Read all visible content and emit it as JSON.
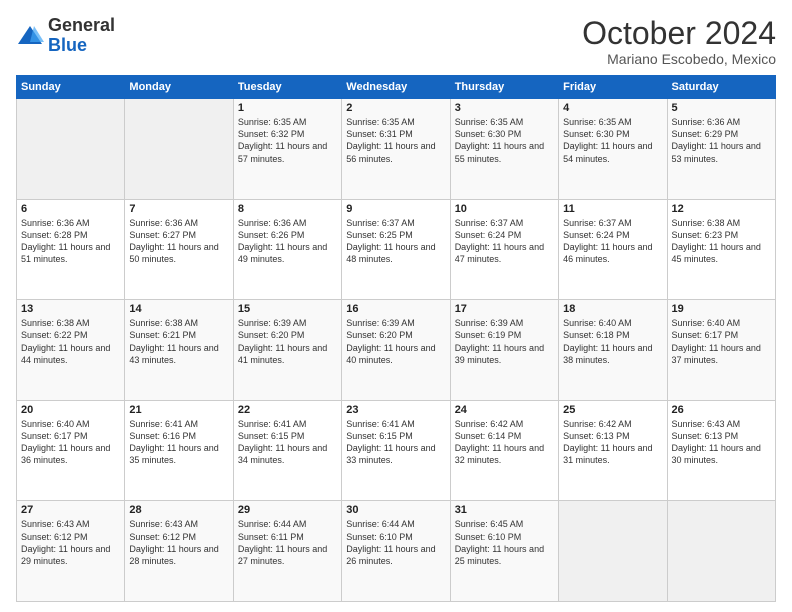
{
  "logo": {
    "general": "General",
    "blue": "Blue"
  },
  "header": {
    "month": "October 2024",
    "location": "Mariano Escobedo, Mexico"
  },
  "days_of_week": [
    "Sunday",
    "Monday",
    "Tuesday",
    "Wednesday",
    "Thursday",
    "Friday",
    "Saturday"
  ],
  "weeks": [
    [
      {
        "day": "",
        "sunrise": "",
        "sunset": "",
        "daylight": ""
      },
      {
        "day": "",
        "sunrise": "",
        "sunset": "",
        "daylight": ""
      },
      {
        "day": "1",
        "sunrise": "Sunrise: 6:35 AM",
        "sunset": "Sunset: 6:32 PM",
        "daylight": "Daylight: 11 hours and 57 minutes."
      },
      {
        "day": "2",
        "sunrise": "Sunrise: 6:35 AM",
        "sunset": "Sunset: 6:31 PM",
        "daylight": "Daylight: 11 hours and 56 minutes."
      },
      {
        "day": "3",
        "sunrise": "Sunrise: 6:35 AM",
        "sunset": "Sunset: 6:30 PM",
        "daylight": "Daylight: 11 hours and 55 minutes."
      },
      {
        "day": "4",
        "sunrise": "Sunrise: 6:35 AM",
        "sunset": "Sunset: 6:30 PM",
        "daylight": "Daylight: 11 hours and 54 minutes."
      },
      {
        "day": "5",
        "sunrise": "Sunrise: 6:36 AM",
        "sunset": "Sunset: 6:29 PM",
        "daylight": "Daylight: 11 hours and 53 minutes."
      }
    ],
    [
      {
        "day": "6",
        "sunrise": "Sunrise: 6:36 AM",
        "sunset": "Sunset: 6:28 PM",
        "daylight": "Daylight: 11 hours and 51 minutes."
      },
      {
        "day": "7",
        "sunrise": "Sunrise: 6:36 AM",
        "sunset": "Sunset: 6:27 PM",
        "daylight": "Daylight: 11 hours and 50 minutes."
      },
      {
        "day": "8",
        "sunrise": "Sunrise: 6:36 AM",
        "sunset": "Sunset: 6:26 PM",
        "daylight": "Daylight: 11 hours and 49 minutes."
      },
      {
        "day": "9",
        "sunrise": "Sunrise: 6:37 AM",
        "sunset": "Sunset: 6:25 PM",
        "daylight": "Daylight: 11 hours and 48 minutes."
      },
      {
        "day": "10",
        "sunrise": "Sunrise: 6:37 AM",
        "sunset": "Sunset: 6:24 PM",
        "daylight": "Daylight: 11 hours and 47 minutes."
      },
      {
        "day": "11",
        "sunrise": "Sunrise: 6:37 AM",
        "sunset": "Sunset: 6:24 PM",
        "daylight": "Daylight: 11 hours and 46 minutes."
      },
      {
        "day": "12",
        "sunrise": "Sunrise: 6:38 AM",
        "sunset": "Sunset: 6:23 PM",
        "daylight": "Daylight: 11 hours and 45 minutes."
      }
    ],
    [
      {
        "day": "13",
        "sunrise": "Sunrise: 6:38 AM",
        "sunset": "Sunset: 6:22 PM",
        "daylight": "Daylight: 11 hours and 44 minutes."
      },
      {
        "day": "14",
        "sunrise": "Sunrise: 6:38 AM",
        "sunset": "Sunset: 6:21 PM",
        "daylight": "Daylight: 11 hours and 43 minutes."
      },
      {
        "day": "15",
        "sunrise": "Sunrise: 6:39 AM",
        "sunset": "Sunset: 6:20 PM",
        "daylight": "Daylight: 11 hours and 41 minutes."
      },
      {
        "day": "16",
        "sunrise": "Sunrise: 6:39 AM",
        "sunset": "Sunset: 6:20 PM",
        "daylight": "Daylight: 11 hours and 40 minutes."
      },
      {
        "day": "17",
        "sunrise": "Sunrise: 6:39 AM",
        "sunset": "Sunset: 6:19 PM",
        "daylight": "Daylight: 11 hours and 39 minutes."
      },
      {
        "day": "18",
        "sunrise": "Sunrise: 6:40 AM",
        "sunset": "Sunset: 6:18 PM",
        "daylight": "Daylight: 11 hours and 38 minutes."
      },
      {
        "day": "19",
        "sunrise": "Sunrise: 6:40 AM",
        "sunset": "Sunset: 6:17 PM",
        "daylight": "Daylight: 11 hours and 37 minutes."
      }
    ],
    [
      {
        "day": "20",
        "sunrise": "Sunrise: 6:40 AM",
        "sunset": "Sunset: 6:17 PM",
        "daylight": "Daylight: 11 hours and 36 minutes."
      },
      {
        "day": "21",
        "sunrise": "Sunrise: 6:41 AM",
        "sunset": "Sunset: 6:16 PM",
        "daylight": "Daylight: 11 hours and 35 minutes."
      },
      {
        "day": "22",
        "sunrise": "Sunrise: 6:41 AM",
        "sunset": "Sunset: 6:15 PM",
        "daylight": "Daylight: 11 hours and 34 minutes."
      },
      {
        "day": "23",
        "sunrise": "Sunrise: 6:41 AM",
        "sunset": "Sunset: 6:15 PM",
        "daylight": "Daylight: 11 hours and 33 minutes."
      },
      {
        "day": "24",
        "sunrise": "Sunrise: 6:42 AM",
        "sunset": "Sunset: 6:14 PM",
        "daylight": "Daylight: 11 hours and 32 minutes."
      },
      {
        "day": "25",
        "sunrise": "Sunrise: 6:42 AM",
        "sunset": "Sunset: 6:13 PM",
        "daylight": "Daylight: 11 hours and 31 minutes."
      },
      {
        "day": "26",
        "sunrise": "Sunrise: 6:43 AM",
        "sunset": "Sunset: 6:13 PM",
        "daylight": "Daylight: 11 hours and 30 minutes."
      }
    ],
    [
      {
        "day": "27",
        "sunrise": "Sunrise: 6:43 AM",
        "sunset": "Sunset: 6:12 PM",
        "daylight": "Daylight: 11 hours and 29 minutes."
      },
      {
        "day": "28",
        "sunrise": "Sunrise: 6:43 AM",
        "sunset": "Sunset: 6:12 PM",
        "daylight": "Daylight: 11 hours and 28 minutes."
      },
      {
        "day": "29",
        "sunrise": "Sunrise: 6:44 AM",
        "sunset": "Sunset: 6:11 PM",
        "daylight": "Daylight: 11 hours and 27 minutes."
      },
      {
        "day": "30",
        "sunrise": "Sunrise: 6:44 AM",
        "sunset": "Sunset: 6:10 PM",
        "daylight": "Daylight: 11 hours and 26 minutes."
      },
      {
        "day": "31",
        "sunrise": "Sunrise: 6:45 AM",
        "sunset": "Sunset: 6:10 PM",
        "daylight": "Daylight: 11 hours and 25 minutes."
      },
      {
        "day": "",
        "sunrise": "",
        "sunset": "",
        "daylight": ""
      },
      {
        "day": "",
        "sunrise": "",
        "sunset": "",
        "daylight": ""
      }
    ]
  ]
}
